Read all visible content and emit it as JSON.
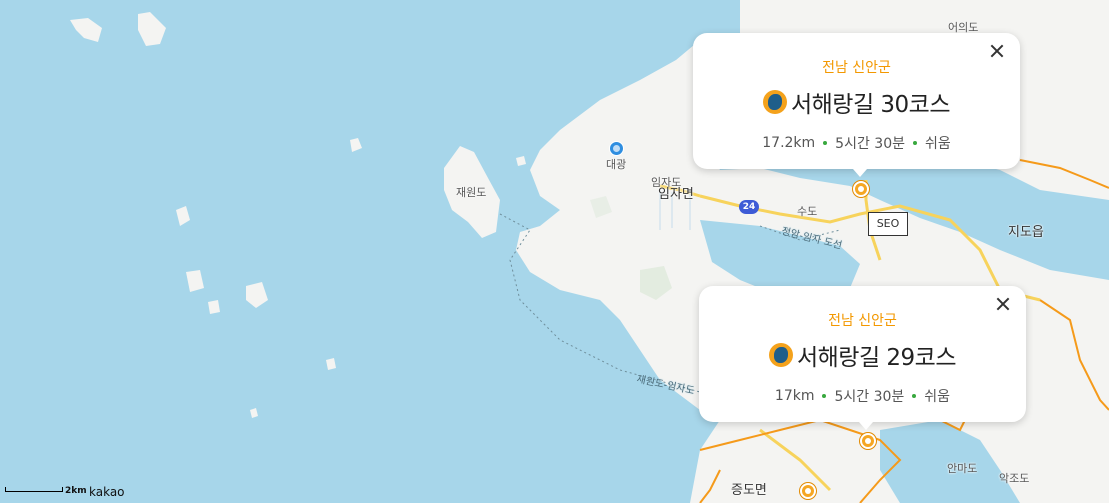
{
  "map": {
    "labels": {
      "eouido": "어의도",
      "jaewondo": "재원도",
      "daegwang": "대광",
      "imjado": "임자도",
      "imjamyeon": "임자면",
      "sudo": "수도",
      "route_jeongam": "정암-임자 도선",
      "route_jaewon": "재원도-임자도",
      "jidoeup": "지도읍",
      "anmado": "안마도",
      "akjodo": "악조도",
      "jeungdomyeon": "증도면",
      "seo": "SEO",
      "road_24": "24"
    },
    "scale_text": "2km",
    "brand": "kakao",
    "colors": {
      "water": "#a7d6ea",
      "land": "#f4f4f2",
      "boundary": "#f59a1a",
      "road": "#f7d35c",
      "accent": "#f39800"
    }
  },
  "popups": [
    {
      "region": "전남 신안군",
      "title": "서해랑길 30코스",
      "distance": "17.2km",
      "time": "5시간 30분",
      "difficulty": "쉬움",
      "close_icon": "close-icon"
    },
    {
      "region": "전남 신안군",
      "title": "서해랑길 29코스",
      "distance": "17km",
      "time": "5시간 30분",
      "difficulty": "쉬움",
      "close_icon": "close-icon"
    }
  ]
}
